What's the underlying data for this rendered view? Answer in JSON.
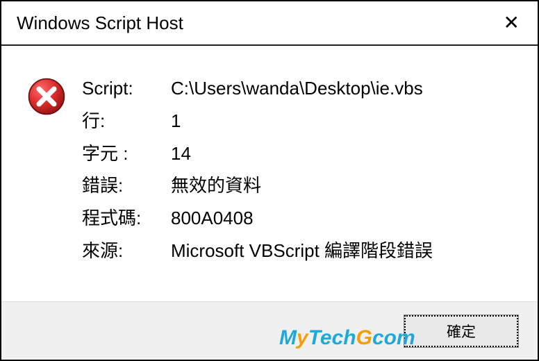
{
  "title": "Windows Script Host",
  "labels": {
    "script": "Script:",
    "line": "行:",
    "char": "字元 :",
    "error": "錯誤:",
    "code": "程式碼:",
    "source": "來源:"
  },
  "values": {
    "script": "C:\\Users\\wanda\\Desktop\\ie.vbs",
    "line": "1",
    "char": "14",
    "error": "無效的資料",
    "code": "800A0408",
    "source": "Microsoft VBScript 編譯階段錯誤"
  },
  "buttons": {
    "ok": "確定"
  },
  "watermark": {
    "m": "M",
    "y": "y",
    "tech": "Tech",
    "g": "G",
    "o1": "o",
    "com": "com"
  }
}
